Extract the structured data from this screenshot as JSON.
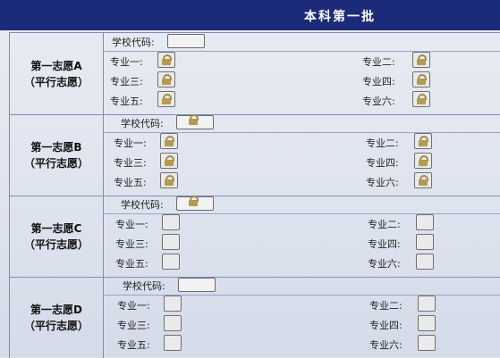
{
  "header": {
    "title": "本科第一批"
  },
  "groups": [
    {
      "name": "第一志愿A",
      "type": "（平行志愿）",
      "school_code_label": "学校代码:",
      "majors": [
        "专业一:",
        "专业二:",
        "专业三:",
        "专业四:",
        "专业五:",
        "专业六:"
      ]
    },
    {
      "name": "第一志愿B",
      "type": "（平行志愿）",
      "school_code_label": "学校代码:",
      "majors": [
        "专业一:",
        "专业二:",
        "专业三:",
        "专业四:",
        "专业五:",
        "专业六:"
      ]
    },
    {
      "name": "第一志愿C",
      "type": "（平行志愿）",
      "school_code_label": "学校代码:",
      "majors": [
        "专业一:",
        "专业二:",
        "专业三:",
        "专业四:",
        "专业五:",
        "专业六:"
      ]
    },
    {
      "name": "第一志愿D",
      "type": "（平行志愿）",
      "school_code_label": "学校代码:",
      "majors": [
        "专业一:",
        "专业二:",
        "专业三:",
        "专业四:",
        "专业五:",
        "专业六:"
      ]
    }
  ],
  "icons": {
    "lock": "lock-icon"
  },
  "colors": {
    "header": "#1c2a7a",
    "grid": "#7f8cb3"
  }
}
